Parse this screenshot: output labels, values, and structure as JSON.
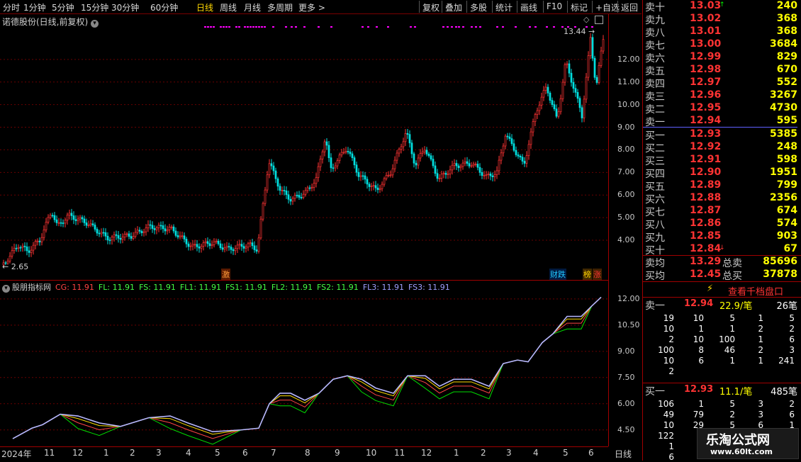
{
  "toolbar": {
    "periods": [
      "分时",
      "1分钟",
      "5分钟",
      "15分钟",
      "30分钟",
      "60分钟",
      "日线",
      "周线",
      "月线",
      "多周期",
      "更多 >"
    ],
    "tools": [
      "复权",
      "叠加",
      "多股",
      "统计",
      "画线",
      "F10",
      "标记",
      "+自选",
      "返回"
    ]
  },
  "price_panel": {
    "title": "诺德股份(日线,前复权)",
    "high_label": "13.44",
    "low_label": "2.65",
    "y_ticks": [
      "12.00",
      "11.00",
      "10.00",
      "9.00",
      "8.00",
      "7.00",
      "6.00",
      "5.00",
      "4.00"
    ],
    "event_badges": [
      {
        "text": "激",
        "color": "#ff9a3a",
        "bg": "#5a1a00"
      },
      {
        "text": "财跌",
        "color": "#22c8ff",
        "bg": "#001a40"
      },
      {
        "text": "榜",
        "color": "#ffd700",
        "bg": "#402800"
      },
      {
        "text": "涨",
        "color": "#ff3333",
        "bg": "#402000"
      }
    ]
  },
  "indicator_panel": {
    "title": "股朋指标网",
    "params": [
      {
        "name": "CG:",
        "value": "11.91",
        "color": "#ff4444"
      },
      {
        "name": "FL:",
        "value": "11.91",
        "color": "#44ff44"
      },
      {
        "name": "FS:",
        "value": "11.91",
        "color": "#44ff44"
      },
      {
        "name": "FL1:",
        "value": "11.91",
        "color": "#44ff44"
      },
      {
        "name": "FS1:",
        "value": "11.91",
        "color": "#44ff44"
      },
      {
        "name": "FL2:",
        "value": "11.91",
        "color": "#44ff44"
      },
      {
        "name": "FS2:",
        "value": "11.91",
        "color": "#44ff44"
      },
      {
        "name": "FL3:",
        "value": "11.91",
        "color": "#a0a0ff"
      },
      {
        "name": "FS3:",
        "value": "11.91",
        "color": "#a0a0ff"
      }
    ],
    "y_ticks": [
      "12.00",
      "10.50",
      "9.00",
      "7.50",
      "6.00",
      "4.50"
    ]
  },
  "date_axis": {
    "labels": [
      "2024年",
      "11",
      "12",
      "1",
      "2",
      "3",
      "4",
      "5",
      "6",
      "7",
      "8",
      "9",
      "10",
      "11",
      "12",
      "1",
      "2",
      "3",
      "4",
      "5",
      "6"
    ],
    "period": "日线"
  },
  "quotes": {
    "sell": [
      {
        "label": "卖十",
        "price": "13.03",
        "vol": "240",
        "mark": "↑"
      },
      {
        "label": "卖九",
        "price": "13.02",
        "vol": "368"
      },
      {
        "label": "卖八",
        "price": "13.01",
        "vol": "368"
      },
      {
        "label": "卖七",
        "price": "13.00",
        "vol": "3684"
      },
      {
        "label": "卖六",
        "price": "12.99",
        "vol": "829"
      },
      {
        "label": "卖五",
        "price": "12.98",
        "vol": "670"
      },
      {
        "label": "卖四",
        "price": "12.97",
        "vol": "552"
      },
      {
        "label": "卖三",
        "price": "12.96",
        "vol": "3267"
      },
      {
        "label": "卖二",
        "price": "12.95",
        "vol": "4730"
      },
      {
        "label": "卖一",
        "price": "12.94",
        "vol": "595"
      }
    ],
    "buy": [
      {
        "label": "买一",
        "price": "12.93",
        "vol": "5385"
      },
      {
        "label": "买二",
        "price": "12.92",
        "vol": "248"
      },
      {
        "label": "买三",
        "price": "12.91",
        "vol": "598"
      },
      {
        "label": "买四",
        "price": "12.90",
        "vol": "1951"
      },
      {
        "label": "买五",
        "price": "12.89",
        "vol": "799"
      },
      {
        "label": "买六",
        "price": "12.88",
        "vol": "2356"
      },
      {
        "label": "买七",
        "price": "12.87",
        "vol": "674"
      },
      {
        "label": "买八",
        "price": "12.86",
        "vol": "574"
      },
      {
        "label": "买九",
        "price": "12.85",
        "vol": "903"
      },
      {
        "label": "买十",
        "price": "12.84",
        "vol": "67",
        "mark": "↓"
      }
    ],
    "avg_sell": {
      "label": "卖均",
      "price": "13.29",
      "total_label": "总卖",
      "total": "85696"
    },
    "avg_buy": {
      "label": "买均",
      "price": "12.45",
      "total_label": "总买",
      "total": "37878"
    },
    "thousand_button": "查看千档盘口",
    "sell1_detail": {
      "label": "卖一",
      "price": "12.94",
      "per": "22.9/笔",
      "count": "26笔"
    },
    "sell1_rows": [
      [
        "19",
        "10",
        "5",
        "1",
        "5"
      ],
      [
        "10",
        "1",
        "1",
        "2",
        "2"
      ],
      [
        "2",
        "10",
        "100",
        "1",
        "6"
      ],
      [
        "100",
        "8",
        "46",
        "2",
        "3"
      ],
      [
        "10",
        "6",
        "1",
        "1",
        "241"
      ],
      [
        "2",
        "",
        "",
        "",
        ""
      ]
    ],
    "buy1_detail": {
      "label": "买一",
      "price": "12.93",
      "per": "11.1/笔",
      "count": "485笔"
    },
    "buy1_rows": [
      [
        "106",
        "1",
        "5",
        "3",
        "2"
      ],
      [
        "49",
        "79",
        "2",
        "3",
        "6"
      ],
      [
        "10",
        "29",
        "5",
        "6",
        "1"
      ],
      [
        "122",
        "",
        "",
        "",
        ""
      ],
      [
        "1",
        "",
        "",
        "",
        ""
      ],
      [
        "6",
        "",
        "",
        "",
        ""
      ]
    ]
  },
  "watermark": {
    "title": "乐淘公式网",
    "url": "www.60lt.com"
  },
  "colors": {
    "up": "#ff3333",
    "down": "#00e0e0",
    "grid": "#7a0000",
    "accent": "#ffd700"
  }
}
